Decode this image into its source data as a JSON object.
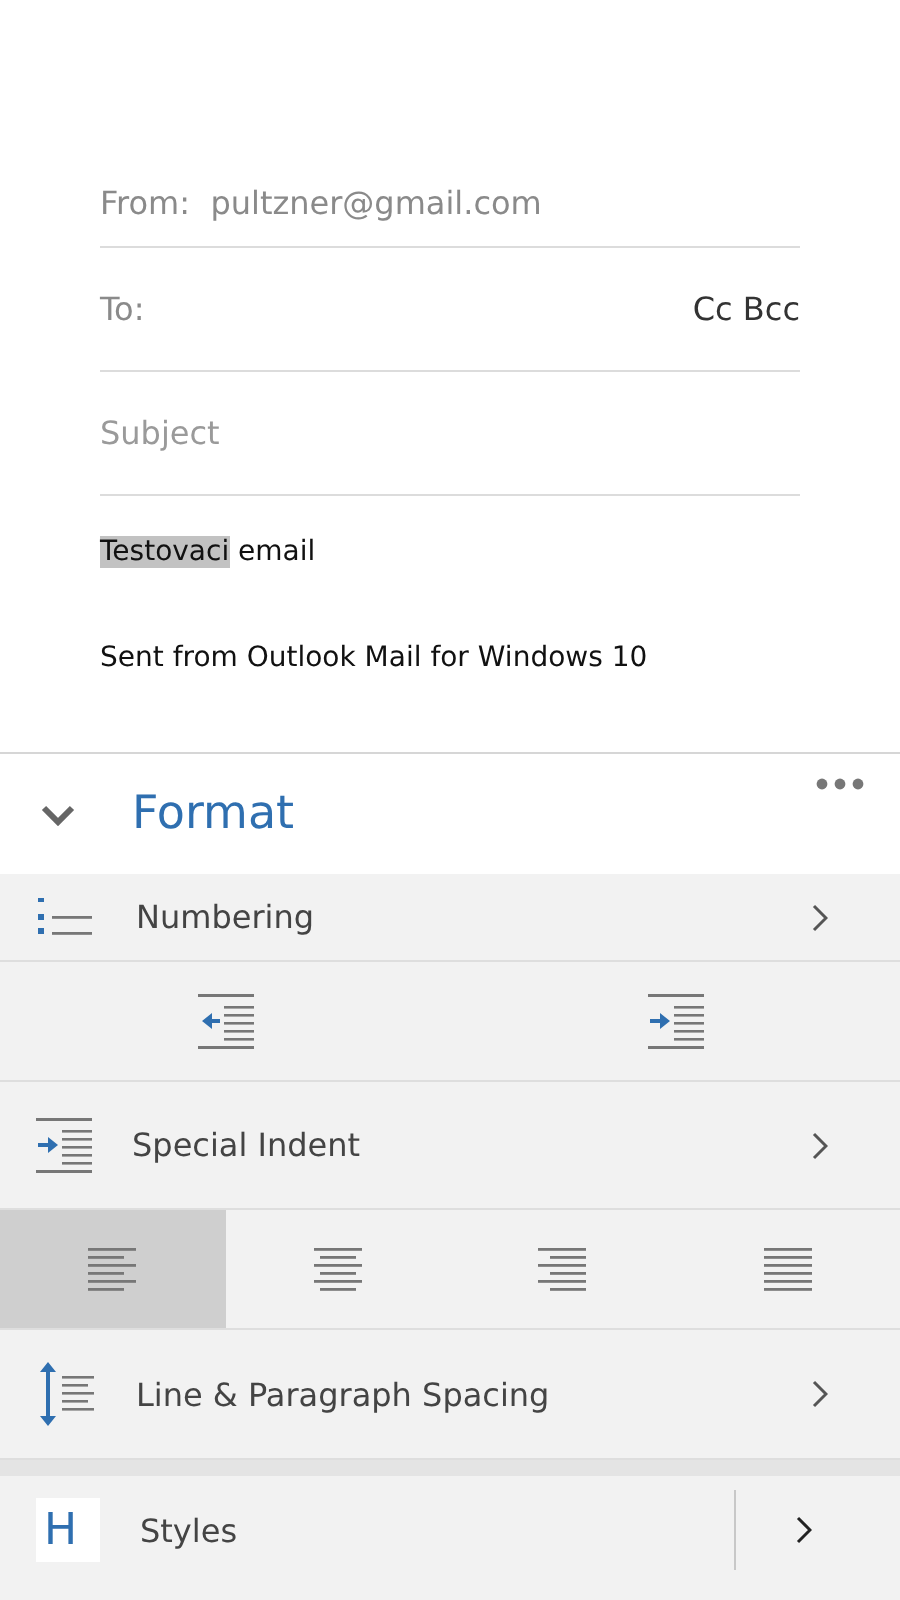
{
  "compose": {
    "from_label": "From:",
    "from_value": "pultzner@gmail.com",
    "to_label": "To:",
    "cc_bcc": "Cc Bcc",
    "subject_placeholder": "Subject",
    "body": [
      {
        "text": "Testovaci",
        "selected": true
      },
      {
        "text": " email",
        "selected": false
      }
    ],
    "signature": "Sent from Outlook Mail for Windows 10"
  },
  "format": {
    "title": "Format",
    "rows": [
      {
        "kind": "numbering",
        "label": "Numbering"
      },
      {
        "kind": "indent"
      },
      {
        "kind": "special-indent",
        "label": "Special Indent"
      },
      {
        "kind": "alignment",
        "options": [
          {
            "selected": true
          },
          {
            "selected": false
          },
          {
            "selected": false
          },
          {
            "selected": false
          }
        ]
      },
      {
        "kind": "spacing",
        "label": "Line & Paragraph Spacing"
      },
      {
        "kind": "styles",
        "preview": "H",
        "label": "Styles"
      }
    ]
  }
}
